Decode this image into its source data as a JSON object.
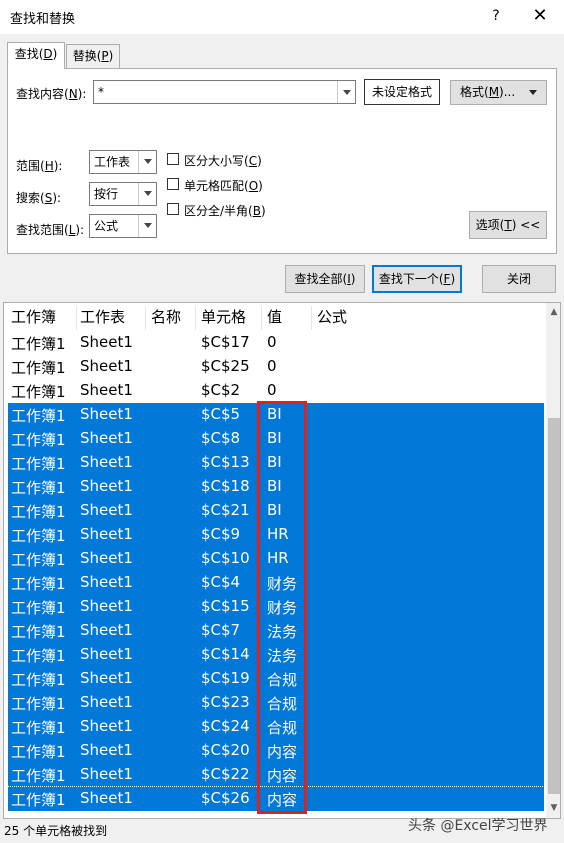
{
  "window": {
    "title": "查找和替换",
    "help": "?",
    "close": "✕"
  },
  "tabs": [
    {
      "label": "查找(",
      "key": "D",
      "end": ")"
    },
    {
      "label": "替换(",
      "key": "P",
      "end": ")"
    }
  ],
  "find": {
    "label_pre": "查找内容(",
    "key": "N",
    "label_post": "):",
    "value": "*",
    "no_format": "未设定格式",
    "format_pre": "格式(",
    "format_key": "M",
    "format_post": ")..."
  },
  "options": {
    "scope": {
      "pre": "范围(",
      "key": "H",
      "post": "):",
      "value": "工作表"
    },
    "search": {
      "pre": "搜索(",
      "key": "S",
      "post": "):",
      "value": "按行"
    },
    "lookin": {
      "pre": "查找范围(",
      "key": "L",
      "post": "):",
      "value": "公式"
    },
    "match_case": {
      "pre": "区分大小写(",
      "key": "C",
      "post": ")"
    },
    "whole_cell": {
      "pre": "单元格匹配(",
      "key": "O",
      "post": ")"
    },
    "byte_width": {
      "pre": "区分全/半角(",
      "key": "B",
      "post": ")"
    },
    "toggle": {
      "pre": "选项(",
      "key": "T",
      "post": ") <<"
    }
  },
  "actions": {
    "find_all": {
      "pre": "查找全部(",
      "key": "I",
      "post": ")"
    },
    "find_next": {
      "pre": "查找下一个(",
      "key": "F",
      "post": ")"
    },
    "close": "关闭"
  },
  "results": {
    "headers": [
      "工作簿",
      "工作表",
      "名称",
      "单元格",
      "值",
      "公式"
    ],
    "rows": [
      {
        "book": "工作簿1",
        "sheet": "Sheet1",
        "cell": "$C$17",
        "value": "0",
        "selected": false
      },
      {
        "book": "工作簿1",
        "sheet": "Sheet1",
        "cell": "$C$25",
        "value": "0",
        "selected": false
      },
      {
        "book": "工作簿1",
        "sheet": "Sheet1",
        "cell": "$C$2",
        "value": "0",
        "selected": false
      },
      {
        "book": "工作簿1",
        "sheet": "Sheet1",
        "cell": "$C$5",
        "value": "BI",
        "selected": true
      },
      {
        "book": "工作簿1",
        "sheet": "Sheet1",
        "cell": "$C$8",
        "value": "BI",
        "selected": true
      },
      {
        "book": "工作簿1",
        "sheet": "Sheet1",
        "cell": "$C$13",
        "value": "BI",
        "selected": true
      },
      {
        "book": "工作簿1",
        "sheet": "Sheet1",
        "cell": "$C$18",
        "value": "BI",
        "selected": true
      },
      {
        "book": "工作簿1",
        "sheet": "Sheet1",
        "cell": "$C$21",
        "value": "BI",
        "selected": true
      },
      {
        "book": "工作簿1",
        "sheet": "Sheet1",
        "cell": "$C$9",
        "value": "HR",
        "selected": true
      },
      {
        "book": "工作簿1",
        "sheet": "Sheet1",
        "cell": "$C$10",
        "value": "HR",
        "selected": true
      },
      {
        "book": "工作簿1",
        "sheet": "Sheet1",
        "cell": "$C$4",
        "value": "财务",
        "selected": true
      },
      {
        "book": "工作簿1",
        "sheet": "Sheet1",
        "cell": "$C$15",
        "value": "财务",
        "selected": true
      },
      {
        "book": "工作簿1",
        "sheet": "Sheet1",
        "cell": "$C$7",
        "value": "法务",
        "selected": true
      },
      {
        "book": "工作簿1",
        "sheet": "Sheet1",
        "cell": "$C$14",
        "value": "法务",
        "selected": true
      },
      {
        "book": "工作簿1",
        "sheet": "Sheet1",
        "cell": "$C$19",
        "value": "合规",
        "selected": true
      },
      {
        "book": "工作簿1",
        "sheet": "Sheet1",
        "cell": "$C$23",
        "value": "合规",
        "selected": true
      },
      {
        "book": "工作簿1",
        "sheet": "Sheet1",
        "cell": "$C$24",
        "value": "合规",
        "selected": true
      },
      {
        "book": "工作簿1",
        "sheet": "Sheet1",
        "cell": "$C$20",
        "value": "内容",
        "selected": true
      },
      {
        "book": "工作簿1",
        "sheet": "Sheet1",
        "cell": "$C$22",
        "value": "内容",
        "selected": true
      },
      {
        "book": "工作簿1",
        "sheet": "Sheet1",
        "cell": "$C$26",
        "value": "内容",
        "selected": true
      }
    ]
  },
  "status": "25 个单元格被找到",
  "watermark": "头条 @Excel学习世界",
  "colors": {
    "selection": "#0078d7",
    "highlight_box": "#e02020"
  }
}
